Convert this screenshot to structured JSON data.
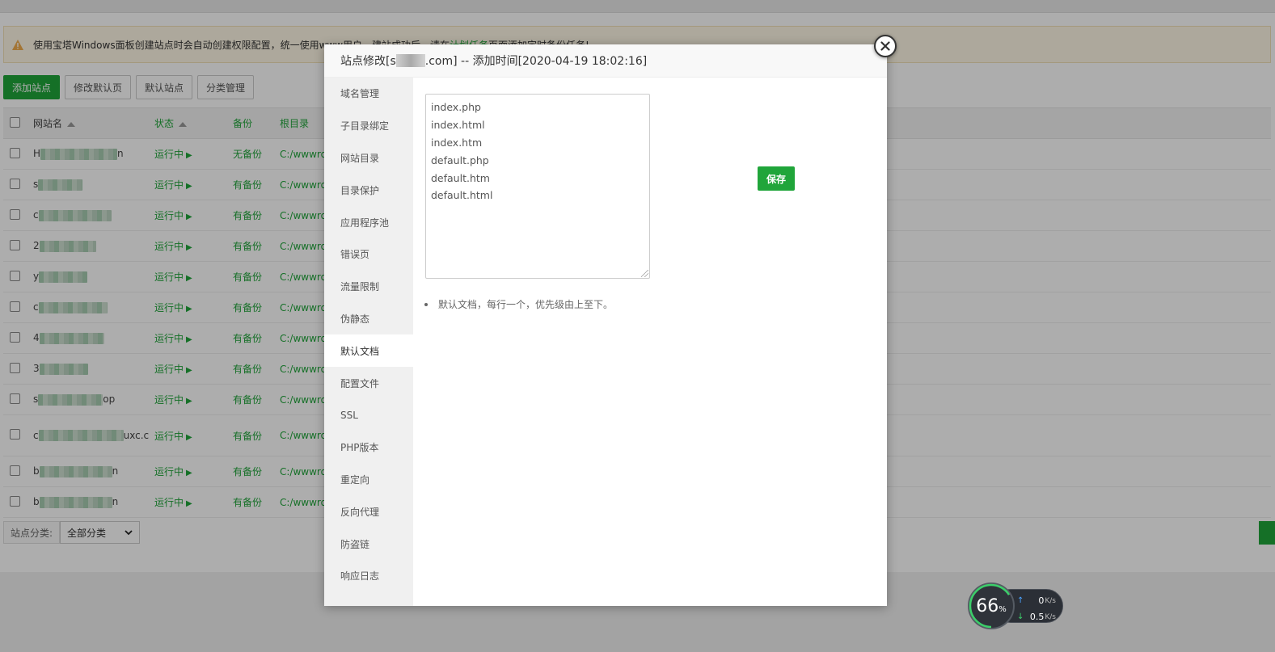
{
  "notice": {
    "text_before": "使用宝塔Windows面板创建站点时会自动创建权限配置，统一使用www用户，建站成功后，请在",
    "link": "计划任务",
    "text_after": "页面添加定时备份任务!"
  },
  "toolbar": {
    "add_site": "添加站点",
    "modify_default_page": "修改默认页",
    "default_site": "默认站点",
    "category_manage": "分类管理"
  },
  "table": {
    "headers": {
      "name": "网站名",
      "status": "状态",
      "backup": "备份",
      "root": "根目录"
    },
    "rows": [
      {
        "name_visible": "H",
        "name_suffix": "n",
        "status": "运行中",
        "backup": "无备份",
        "root": "C:/wwwro"
      },
      {
        "name_visible": "s",
        "name_suffix": "",
        "status": "运行中",
        "backup": "有备份",
        "root": "C:/wwwro"
      },
      {
        "name_visible": "c",
        "name_suffix": "",
        "status": "运行中",
        "backup": "有备份",
        "root": "C:/wwwro"
      },
      {
        "name_visible": "2",
        "name_suffix": "",
        "status": "运行中",
        "backup": "有备份",
        "root": "C:/wwwro"
      },
      {
        "name_visible": "y",
        "name_suffix": "",
        "status": "运行中",
        "backup": "有备份",
        "root": "C:/wwwro"
      },
      {
        "name_visible": "c",
        "name_suffix": "",
        "status": "运行中",
        "backup": "有备份",
        "root": "C:/wwwro"
      },
      {
        "name_visible": "4",
        "name_suffix": "",
        "status": "运行中",
        "backup": "有备份",
        "root": "C:/wwwro"
      },
      {
        "name_visible": "3",
        "name_suffix": "",
        "status": "运行中",
        "backup": "有备份",
        "root": "C:/wwwro"
      },
      {
        "name_visible": "s",
        "name_suffix": "op",
        "status": "运行中",
        "backup": "有备份",
        "root": "C:/wwwro"
      },
      {
        "name_visible": "c",
        "name_suffix": "uxc.c",
        "status": "运行中",
        "backup": "有备份",
        "root": "C:/wwwro"
      },
      {
        "name_visible": "b",
        "name_suffix": "n",
        "status": "运行中",
        "backup": "有备份",
        "root": "C:/wwwro"
      },
      {
        "name_visible": "b",
        "name_suffix": "n",
        "status": "运行中",
        "backup": "有备份",
        "root": "C:/wwwro"
      }
    ]
  },
  "footer": {
    "category_label": "站点分类:",
    "category_value": "全部分类"
  },
  "modal": {
    "title_prefix": "站点修改[s",
    "title_suffix": ".com] -- 添加时间[2020-04-19 18:02:16]",
    "nav": [
      "域名管理",
      "子目录绑定",
      "网站目录",
      "目录保护",
      "应用程序池",
      "错误页",
      "流量限制",
      "伪静态",
      "默认文档",
      "配置文件",
      "SSL",
      "PHP版本",
      "重定向",
      "反向代理",
      "防盗链",
      "响应日志"
    ],
    "active_nav_index": 8,
    "default_docs": [
      "index.php",
      "index.html",
      "index.htm",
      "default.php",
      "default.htm",
      "default.html"
    ],
    "save_label": "保存",
    "tip": "默认文档，每行一个，优先级由上至下。"
  },
  "net_widget": {
    "cpu_percent": "66",
    "percent_sign": "%",
    "up_value": "0",
    "up_unit": "K/s",
    "down_value": "0.5",
    "down_unit": "K/s"
  },
  "colors": {
    "accent": "#20a53a",
    "warning": "#f0ad4e"
  },
  "icons": {
    "warning": "warning-triangle-icon",
    "close": "close-icon",
    "sort": "sort-up-icon",
    "play": "play-icon",
    "up": "arrow-up-icon",
    "down": "arrow-down-icon"
  }
}
